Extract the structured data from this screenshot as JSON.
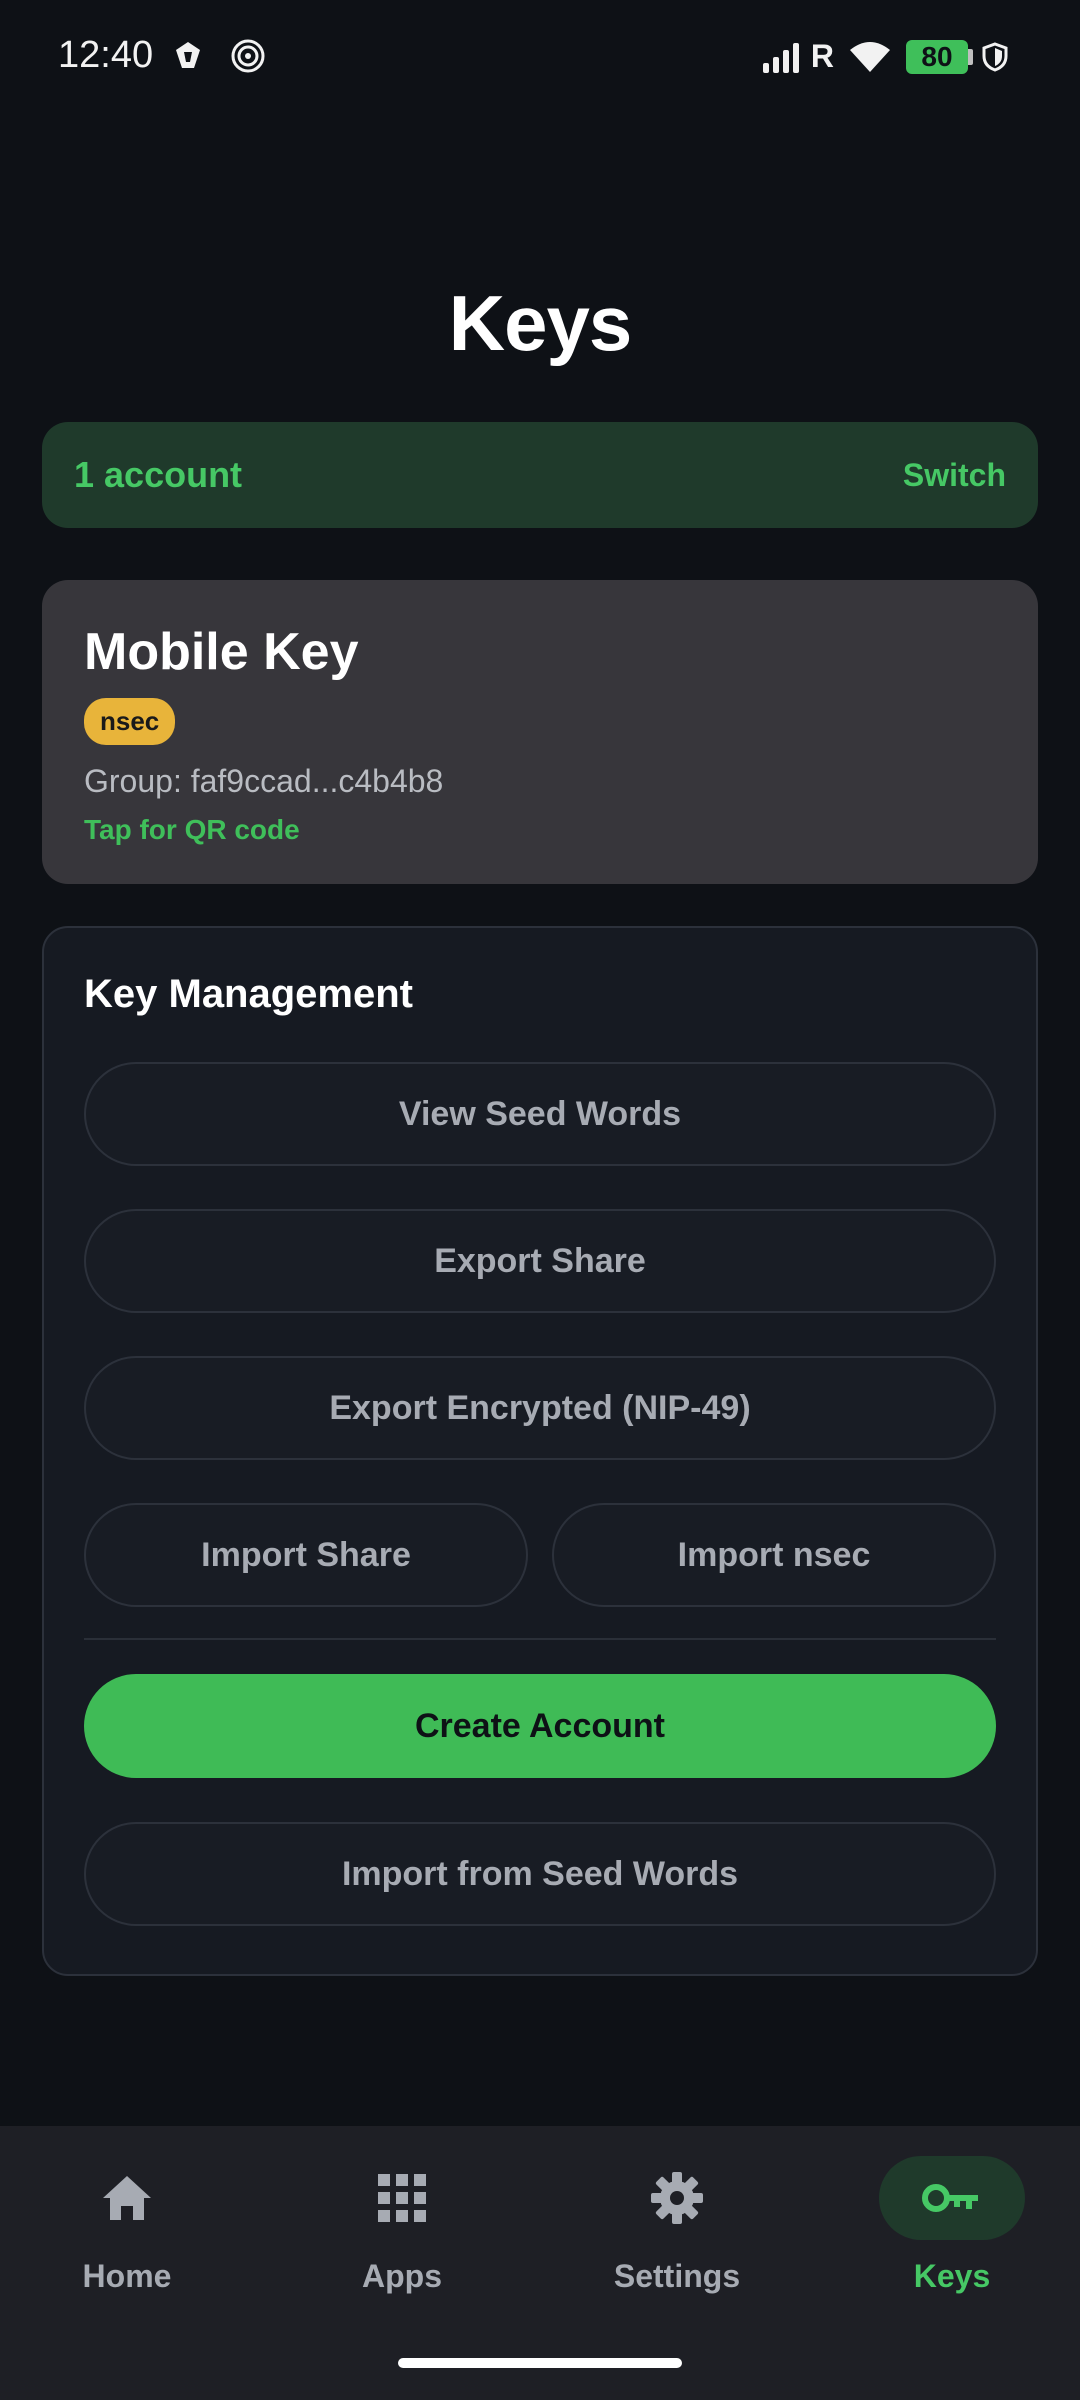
{
  "status_bar": {
    "time": "12:40",
    "battery": "80",
    "network_letter": "R"
  },
  "header": {
    "title": "Keys"
  },
  "account_bar": {
    "count_label": "1 account",
    "switch_label": "Switch"
  },
  "key_card": {
    "name": "Mobile Key",
    "badge": "nsec",
    "group": "Group: faf9ccad...c4b4b8",
    "qr_hint": "Tap for QR code"
  },
  "key_management": {
    "title": "Key Management",
    "view_seed_words": "View Seed Words",
    "export_share": "Export Share",
    "export_encrypted": "Export Encrypted (NIP-49)",
    "import_share": "Import Share",
    "import_nsec": "Import nsec",
    "create_account": "Create Account",
    "import_seed_words": "Import from Seed Words"
  },
  "bottom_nav": {
    "items": [
      {
        "label": "Home",
        "icon": "home-icon"
      },
      {
        "label": "Apps",
        "icon": "apps-grid-icon"
      },
      {
        "label": "Settings",
        "icon": "gear-icon"
      },
      {
        "label": "Keys",
        "icon": "key-icon"
      }
    ],
    "active": "Keys"
  },
  "colors": {
    "background": "#0e1116",
    "accent_green": "#3fbb56",
    "badge_yellow": "#e8b43a"
  }
}
